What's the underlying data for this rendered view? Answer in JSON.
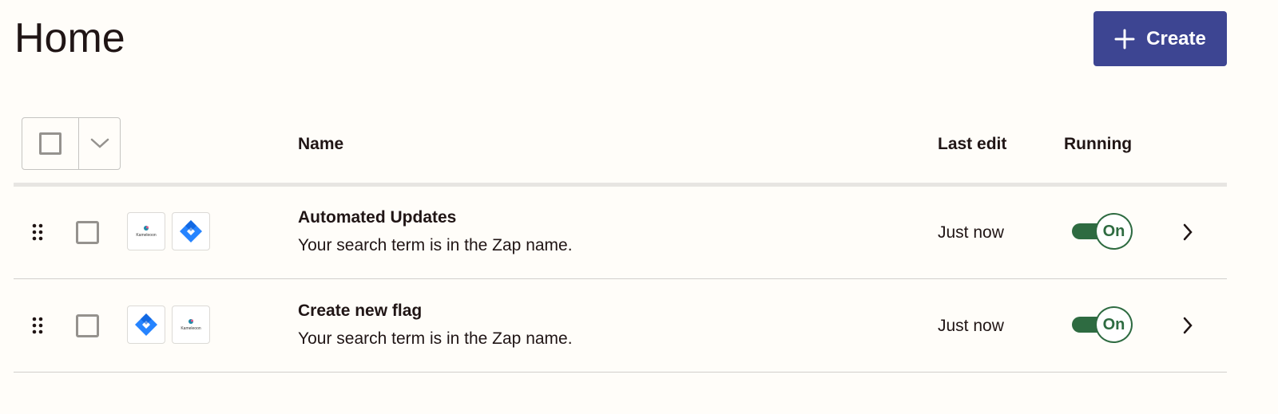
{
  "page": {
    "title": "Home"
  },
  "toolbar": {
    "create_label": "Create",
    "create_icon": "plus-icon"
  },
  "table": {
    "select_all_icon": "checkbox-icon",
    "select_menu_icon": "chevron-down-icon",
    "columns": {
      "name": "Name",
      "last_edit": "Last edit",
      "running": "Running"
    },
    "rows": [
      {
        "title": "Automated Updates",
        "description": "Your search term is in the Zap name.",
        "last_edit": "Just now",
        "running_label": "On",
        "apps": [
          "kameleoon",
          "jira"
        ],
        "kameleoon_wordmark": "Kameleoon"
      },
      {
        "title": "Create new flag",
        "description": "Your search term is in the Zap name.",
        "last_edit": "Just now",
        "running_label": "On",
        "apps": [
          "jira",
          "kameleoon"
        ],
        "kameleoon_wordmark": "Kameleoon"
      }
    ]
  },
  "colors": {
    "create_button": "#3d4592",
    "toggle_on": "#2e6b41",
    "background": "#fffdf9",
    "jira_blue": "#2684ff"
  }
}
